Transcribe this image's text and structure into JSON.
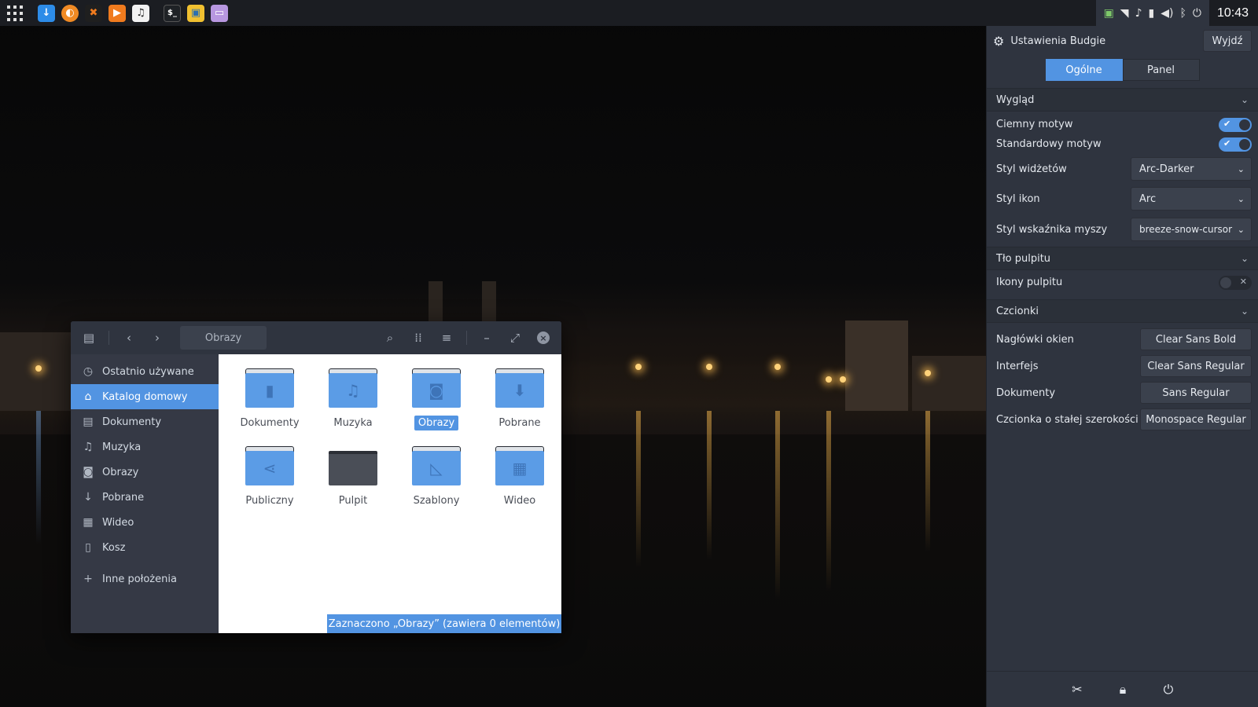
{
  "top_panel": {
    "launchers": [
      {
        "icon": "apps-grid-icon"
      },
      {
        "icon": "download-manager-icon",
        "color": "#2d8ce8"
      },
      {
        "icon": "firefox-icon",
        "color": "#f08a24"
      },
      {
        "icon": "games-icon",
        "color": "#e85d1a"
      },
      {
        "icon": "media-player-icon",
        "color": "#f07b1e"
      },
      {
        "icon": "music-icon",
        "color": "#f2f2f2"
      },
      {
        "icon": "terminal-icon",
        "color": "#1f2226"
      },
      {
        "icon": "image-viewer-icon",
        "color": "#f0c030"
      },
      {
        "icon": "files-icon",
        "color": "#b897e0"
      }
    ],
    "clock": "10:43"
  },
  "file_manager": {
    "path": "Obrazy",
    "sidebar": [
      {
        "label": "Ostatnio używane",
        "icon": "clock-icon",
        "active": false
      },
      {
        "label": "Katalog domowy",
        "icon": "home-icon",
        "active": true
      },
      {
        "label": "Dokumenty",
        "icon": "document-icon",
        "active": false
      },
      {
        "label": "Muzyka",
        "icon": "music-note-icon",
        "active": false
      },
      {
        "label": "Obrazy",
        "icon": "camera-icon",
        "active": false
      },
      {
        "label": "Pobrane",
        "icon": "download-icon",
        "active": false
      },
      {
        "label": "Wideo",
        "icon": "film-icon",
        "active": false
      },
      {
        "label": "Kosz",
        "icon": "trash-icon",
        "active": false
      },
      {
        "label": "Inne położenia",
        "icon": "plus-icon",
        "active": false
      }
    ],
    "files": [
      {
        "label": "Dokumenty",
        "icon": "document-icon"
      },
      {
        "label": "Muzyka",
        "icon": "music-note-icon"
      },
      {
        "label": "Obrazy",
        "icon": "camera-icon",
        "selected": true
      },
      {
        "label": "Pobrane",
        "icon": "download-icon"
      },
      {
        "label": "Publiczny",
        "icon": "share-icon"
      },
      {
        "label": "Pulpit",
        "icon": "desktop-icon"
      },
      {
        "label": "Szablony",
        "icon": "template-icon"
      },
      {
        "label": "Wideo",
        "icon": "film-icon"
      }
    ],
    "status": "Zaznaczono „Obrazy” (zawiera 0 elementów)"
  },
  "budgie_settings": {
    "title": "Ustawienia Budgie",
    "exit_label": "Wyjdź",
    "tabs": [
      {
        "label": "Ogólne",
        "active": true
      },
      {
        "label": "Panel",
        "active": false
      }
    ],
    "appearance": {
      "heading": "Wygląd",
      "dark_theme_label": "Ciemny motyw",
      "dark_theme_on": true,
      "default_theme_label": "Standardowy motyw",
      "default_theme_on": true,
      "widget_style_label": "Styl widżetów",
      "widget_style_value": "Arc-Darker",
      "icon_style_label": "Styl ikon",
      "icon_style_value": "Arc",
      "cursor_style_label": "Styl wskaźnika myszy",
      "cursor_style_value": "breeze-snow-cursor"
    },
    "desktop": {
      "heading": "Tło pulpitu",
      "icons_label": "Ikony pulpitu",
      "icons_on": false
    },
    "fonts": {
      "heading": "Czcionki",
      "rows": [
        {
          "label": "Nagłówki okien",
          "value": "Clear Sans Bold"
        },
        {
          "label": "Interfejs",
          "value": "Clear Sans Regular"
        },
        {
          "label": "Dokumenty",
          "value": "Sans Regular"
        },
        {
          "label": "Czcionka o stałej szerokości",
          "value": "Monospace Regular"
        }
      ]
    },
    "accent_color": "#5294e2"
  }
}
